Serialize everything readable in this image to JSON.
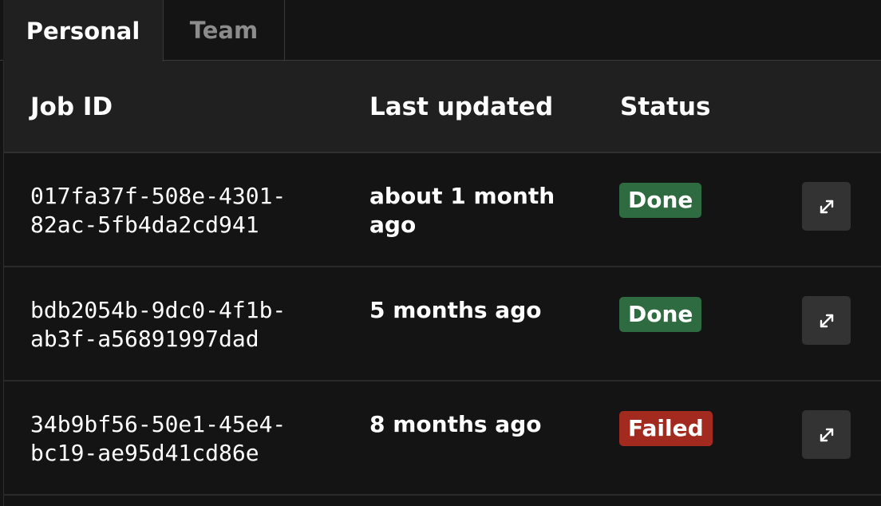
{
  "tabs": [
    {
      "label": "Personal",
      "active": true
    },
    {
      "label": "Team",
      "active": false
    }
  ],
  "table": {
    "columns": [
      "Job ID",
      "Last updated",
      "Status"
    ],
    "rows": [
      {
        "job_id": "017fa37f-508e-4301-82ac-5fb4da2cd941",
        "job_id_line1": "017fa37f-508e-4301-",
        "job_id_line2": "82ac-5fb4da2cd941",
        "last_updated": "about 1 month ago",
        "status": "Done",
        "action_icon": "expand-icon"
      },
      {
        "job_id": "bdb2054b-9dc0-4f1b-ab3f-a56891997dad",
        "job_id_line1": "bdb2054b-9dc0-4f1b-",
        "job_id_line2": "ab3f-a56891997dad",
        "last_updated": "5 months ago",
        "status": "Done",
        "action_icon": "expand-icon"
      },
      {
        "job_id": "34b9bf56-50e1-45e4-bc19-ae95d41cd86e",
        "job_id_line1": "34b9bf56-50e1-45e4-",
        "job_id_line2": "bc19-ae95d41cd86e",
        "last_updated": "8 months ago",
        "status": "Failed",
        "action_icon": "expand-icon"
      }
    ]
  },
  "colors": {
    "status_done": "#2e6b40",
    "status_failed": "#a32a1e",
    "background": "#141414",
    "header_background": "#202020",
    "active_tab_text": "#ffffff",
    "inactive_tab_text": "#8c8c8c"
  }
}
